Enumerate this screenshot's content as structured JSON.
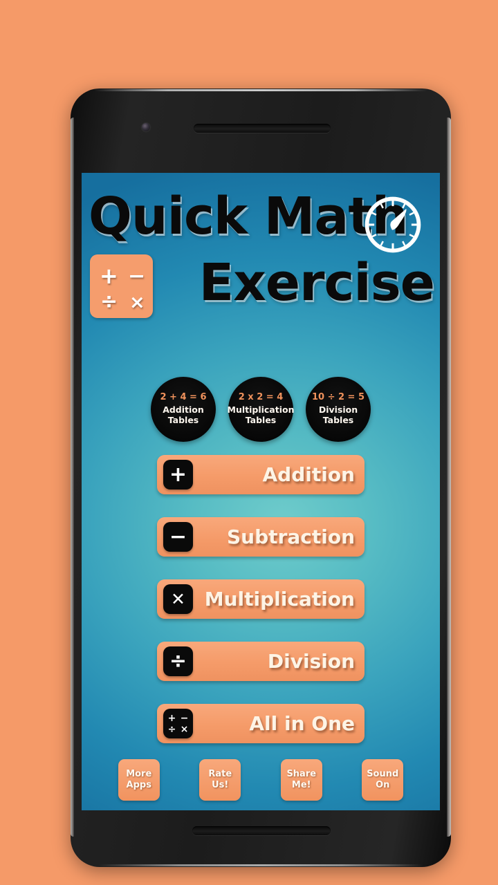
{
  "page": {
    "background_color": "#f59a68"
  },
  "device": {
    "name": "smartphone-mockup",
    "body_color": "#1c1c1c"
  },
  "app": {
    "screen_background_center": "#6fcccb",
    "screen_background_edge": "#166f9f",
    "accent_color": "#f59d6d",
    "title_line1": "Quick Math",
    "title_line2": "Exercise",
    "clock_icon": "stopwatch-icon",
    "calc_badge": {
      "name": "calculator-badge-icon",
      "glyphs": [
        "+",
        "−",
        "÷",
        "×"
      ]
    }
  },
  "tables": [
    {
      "id": "addition-tables",
      "equation": "2 + 4 = 6",
      "line1": "Addition",
      "line2": "Tables"
    },
    {
      "id": "multiplication-tables",
      "equation": "2 x 2 = 4",
      "line1": "Multiplication",
      "line2": "Tables"
    },
    {
      "id": "division-tables",
      "equation": "10 ÷ 2 = 5",
      "line1": "Division",
      "line2": "Tables"
    }
  ],
  "operations": [
    {
      "id": "addition",
      "label": "Addition",
      "icon": "plus-icon",
      "glyph": "+",
      "grid": null
    },
    {
      "id": "subtraction",
      "label": "Subtraction",
      "icon": "minus-icon",
      "glyph": "−",
      "grid": null
    },
    {
      "id": "multiplication",
      "label": "Multiplication",
      "icon": "multiply-icon",
      "glyph": "✕",
      "grid": null
    },
    {
      "id": "division",
      "label": "Division",
      "icon": "divide-icon",
      "glyph": "÷",
      "grid": null
    },
    {
      "id": "all-in-one",
      "label": "All in One",
      "icon": "calculator-icon",
      "glyph": null,
      "grid": [
        "+",
        "−",
        "÷",
        "×"
      ]
    }
  ],
  "footer": [
    {
      "id": "more-apps",
      "line1": "More",
      "line2": "Apps"
    },
    {
      "id": "rate-us",
      "line1": "Rate",
      "line2": "Us!"
    },
    {
      "id": "share-me",
      "line1": "Share",
      "line2": "Me!"
    },
    {
      "id": "sound-on",
      "line1": "Sound",
      "line2": "On"
    }
  ]
}
